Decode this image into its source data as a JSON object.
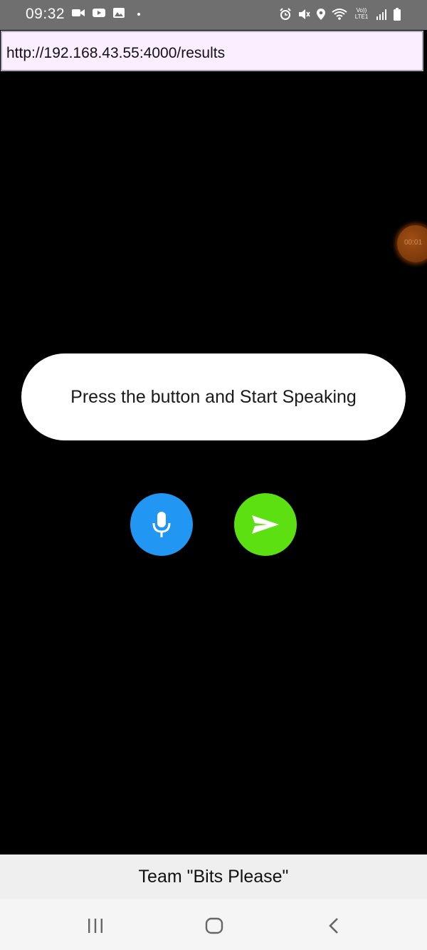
{
  "status_bar": {
    "time": "09:32",
    "left_icons": [
      "video-camera-icon",
      "youtube-icon",
      "gallery-icon",
      "dot-icon"
    ],
    "right_icons": [
      "alarm-icon",
      "mute-icon",
      "location-icon",
      "wifi-icon",
      "volte-lte-icon",
      "signal-icon",
      "battery-icon"
    ],
    "volte_label_top": "Vo))",
    "volte_label_bottom": "LTE1"
  },
  "browser": {
    "url": "http://192.168.43.55:4000/results"
  },
  "floating_timer": {
    "text": "00:01"
  },
  "main": {
    "prompt": "Press the button and Start Speaking",
    "mic_button_icon": "microphone-icon",
    "send_button_icon": "send-icon",
    "colors": {
      "mic": "#2196f3",
      "send": "#5ce012"
    }
  },
  "footer": {
    "text": "Team \"Bits Please\""
  },
  "nav_bar": {
    "buttons": [
      "recent-apps-icon",
      "home-icon",
      "back-icon"
    ]
  }
}
